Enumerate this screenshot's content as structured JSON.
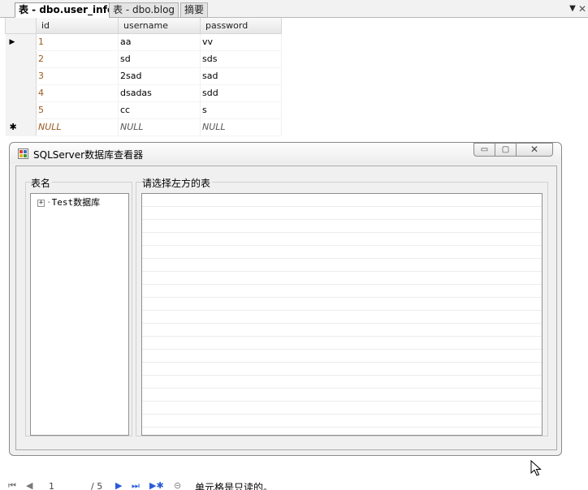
{
  "tabs": [
    {
      "label": "表 - dbo.user_info",
      "active": true
    },
    {
      "label": "表 - dbo.blog",
      "active": false
    },
    {
      "label": "摘要",
      "active": false
    }
  ],
  "tab_controls": {
    "dropdown_icon": "chevron-down-icon",
    "close_icon": "close-icon"
  },
  "grid": {
    "columns": [
      "id",
      "username",
      "password"
    ],
    "rows": [
      {
        "id": "1",
        "username": "aa",
        "password": "vv"
      },
      {
        "id": "2",
        "username": "sd",
        "password": "sds"
      },
      {
        "id": "3",
        "username": "2sad",
        "password": "sad"
      },
      {
        "id": "4",
        "username": "dsadas",
        "password": "sdd"
      },
      {
        "id": "5",
        "username": "cc",
        "password": "s"
      }
    ],
    "new_row": {
      "id": "NULL",
      "username": "NULL",
      "password": "NULL"
    },
    "current_row_glyph": "▶",
    "new_row_glyph": "✱"
  },
  "window": {
    "title": "SQLServer数据库查看器",
    "left_group_label": "表名",
    "right_group_label": "请选择左方的表",
    "tree_root": "Test数据库",
    "tree_expander": "+",
    "min_glyph": "▭",
    "max_glyph": "▢",
    "close_glyph": "✕"
  },
  "navigator": {
    "current": "1",
    "total": "/ 5",
    "status": "单元格是只读的。"
  },
  "colors": {
    "id_text": "#9b5a1e",
    "window_bg": "#f0f0f0"
  }
}
